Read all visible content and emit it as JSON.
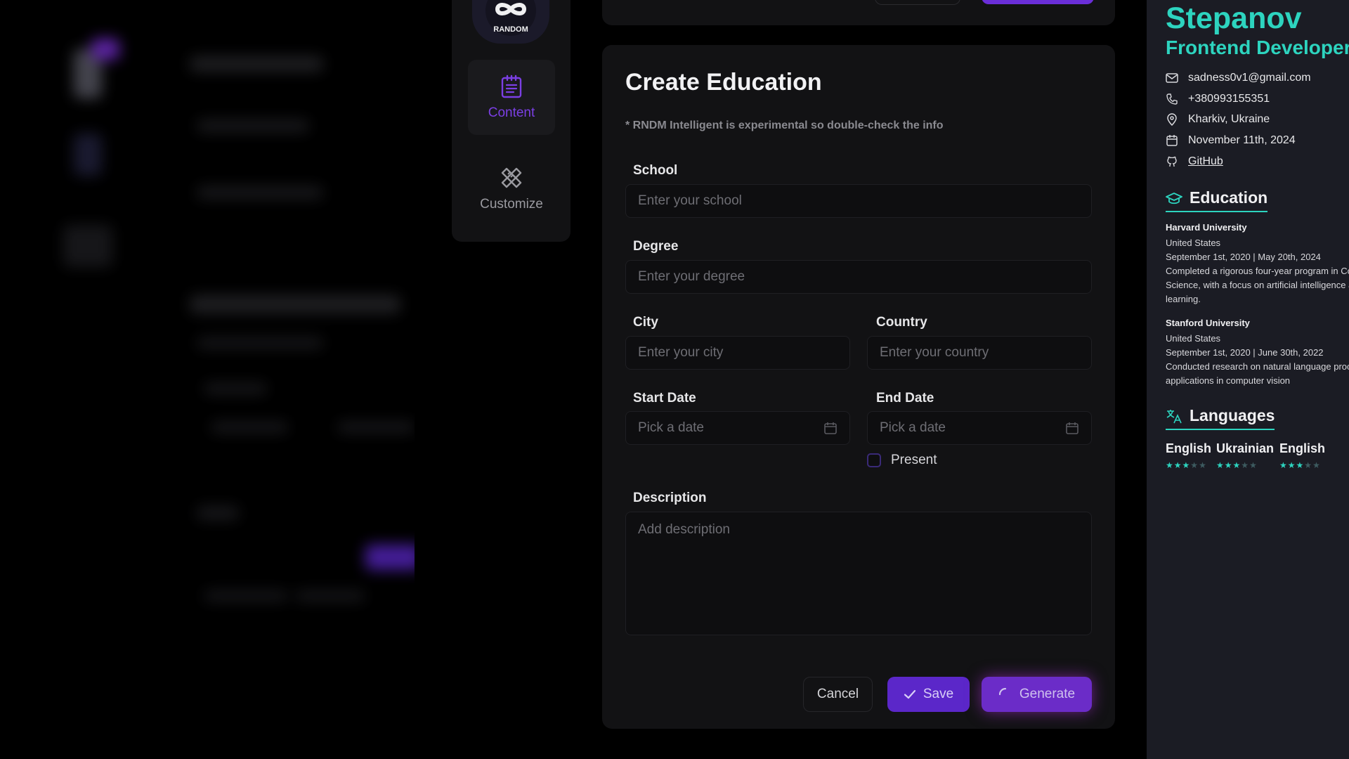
{
  "app": {
    "logo_text": "RANDOM",
    "tools": [
      {
        "label": "Content",
        "icon": "clipboard-list-icon",
        "active": true
      },
      {
        "label": "Customize",
        "icon": "pencil-ruler-icon",
        "active": false
      }
    ]
  },
  "form": {
    "title": "Create Education",
    "note": "* RNDM Intelligent is experimental so double-check the info",
    "school": {
      "label": "School",
      "placeholder": "Enter your school",
      "value": ""
    },
    "degree": {
      "label": "Degree",
      "placeholder": "Enter your degree",
      "value": ""
    },
    "city": {
      "label": "City",
      "placeholder": "Enter your city",
      "value": ""
    },
    "country": {
      "label": "Country",
      "placeholder": "Enter your country",
      "value": ""
    },
    "start_date": {
      "label": "Start Date",
      "placeholder": "Pick a date"
    },
    "end_date": {
      "label": "End Date",
      "placeholder": "Pick a date"
    },
    "present": {
      "label": "Present",
      "checked": false
    },
    "description": {
      "label": "Description",
      "placeholder": "Add description",
      "value": ""
    },
    "buttons": {
      "cancel": "Cancel",
      "save": "Save",
      "generate": "Generate"
    }
  },
  "resume": {
    "name": "Stepanov",
    "title": "Frontend Developer",
    "contacts": {
      "email": "sadness0v1@gmail.com",
      "phone": "+380993155351",
      "location": "Kharkiv, Ukraine",
      "date": "November 11th, 2024",
      "github": "GitHub"
    },
    "education_heading": "Education",
    "education": [
      {
        "school": "Harvard University",
        "country": "United States",
        "dates": "September 1st, 2020 | May 20th, 2024",
        "description": [
          "Completed a rigorous four-year program in Co",
          "Science, with a focus on artificial intelligence a",
          "learning."
        ]
      },
      {
        "school": "Stanford University",
        "country": "United States",
        "dates": "September 1st, 2020 | June 30th, 2022",
        "description": [
          "Conducted research on natural language proc",
          "applications in computer vision"
        ]
      }
    ],
    "languages_heading": "Languages",
    "languages": [
      {
        "name": "English",
        "rating": 3
      },
      {
        "name": "Ukrainian",
        "rating": 3
      },
      {
        "name": "English",
        "rating": 3
      }
    ]
  },
  "colors": {
    "accent_purple": "#6b2cc8",
    "accent_teal": "#2dd4bf",
    "card_bg": "#121214",
    "resume_bg": "#1b1c24"
  }
}
